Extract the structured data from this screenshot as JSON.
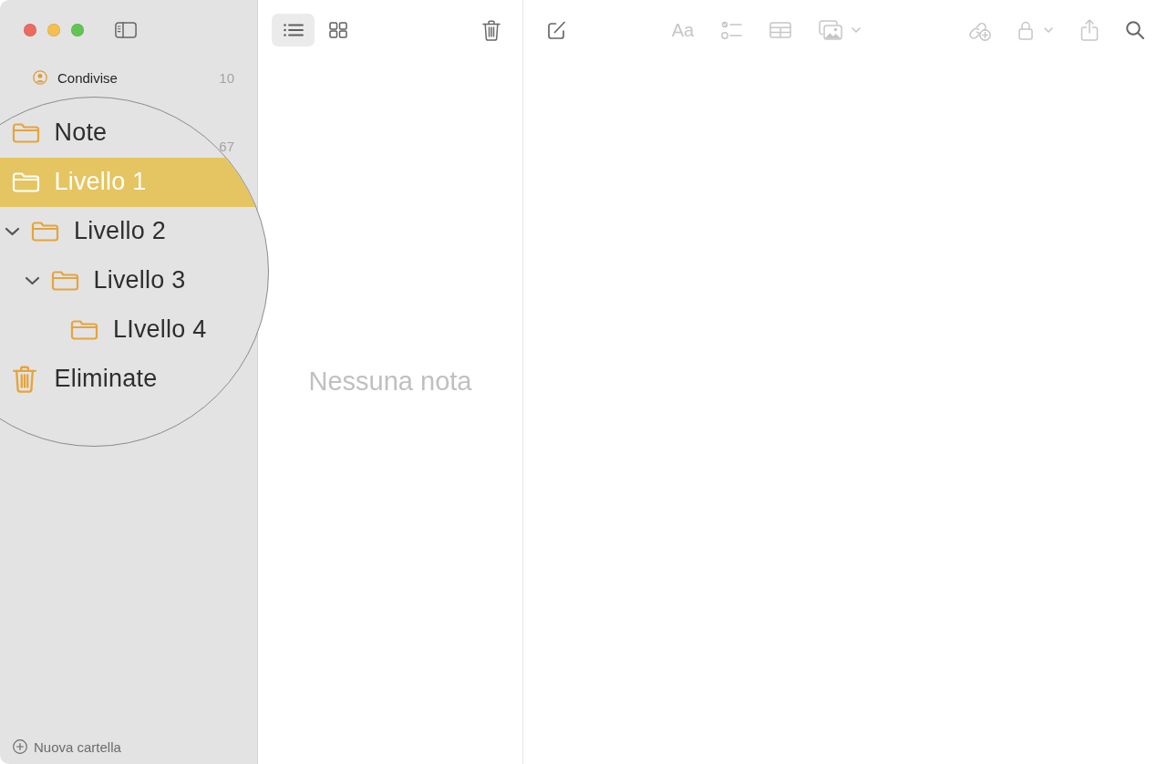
{
  "sidebar": {
    "shared_item": {
      "label": "Condivise",
      "count": "10"
    },
    "partly_covered_count": "67",
    "magnifier": {
      "items": [
        {
          "kind": "folder",
          "label": "Note",
          "selected": false
        },
        {
          "kind": "folder",
          "label": "Livello 1",
          "selected": true,
          "expanded": true,
          "children": [
            {
              "kind": "folder",
              "label": "Livello 2",
              "selected": false,
              "expanded": true,
              "children": [
                {
                  "kind": "folder",
                  "label": "Livello 3",
                  "selected": false,
                  "expanded": true,
                  "children": [
                    {
                      "kind": "folder",
                      "label": "LIvello 4",
                      "selected": false
                    }
                  ]
                }
              ]
            }
          ]
        },
        {
          "kind": "trash",
          "label": "Eliminate",
          "selected": false
        }
      ]
    },
    "new_folder_button": {
      "label": "Nuova cartella"
    }
  },
  "note_list": {
    "view_buttons": [
      {
        "kind": "list",
        "selected": true
      },
      {
        "kind": "gallery",
        "selected": false
      }
    ],
    "empty_message": "Nessuna nota"
  },
  "editor": {
    "toolbar": {
      "left": [
        {
          "kind": "compose",
          "disabled": false
        }
      ],
      "middle": [
        {
          "kind": "format",
          "label": "Aa",
          "disabled": true
        },
        {
          "kind": "checklist",
          "disabled": true
        },
        {
          "kind": "table",
          "disabled": true
        },
        {
          "kind": "media",
          "disabled": true
        }
      ],
      "right": [
        {
          "kind": "collaborate",
          "disabled": true
        },
        {
          "kind": "lock",
          "disabled": true
        },
        {
          "kind": "share",
          "disabled": true
        },
        {
          "kind": "search",
          "disabled": false
        }
      ]
    }
  }
}
